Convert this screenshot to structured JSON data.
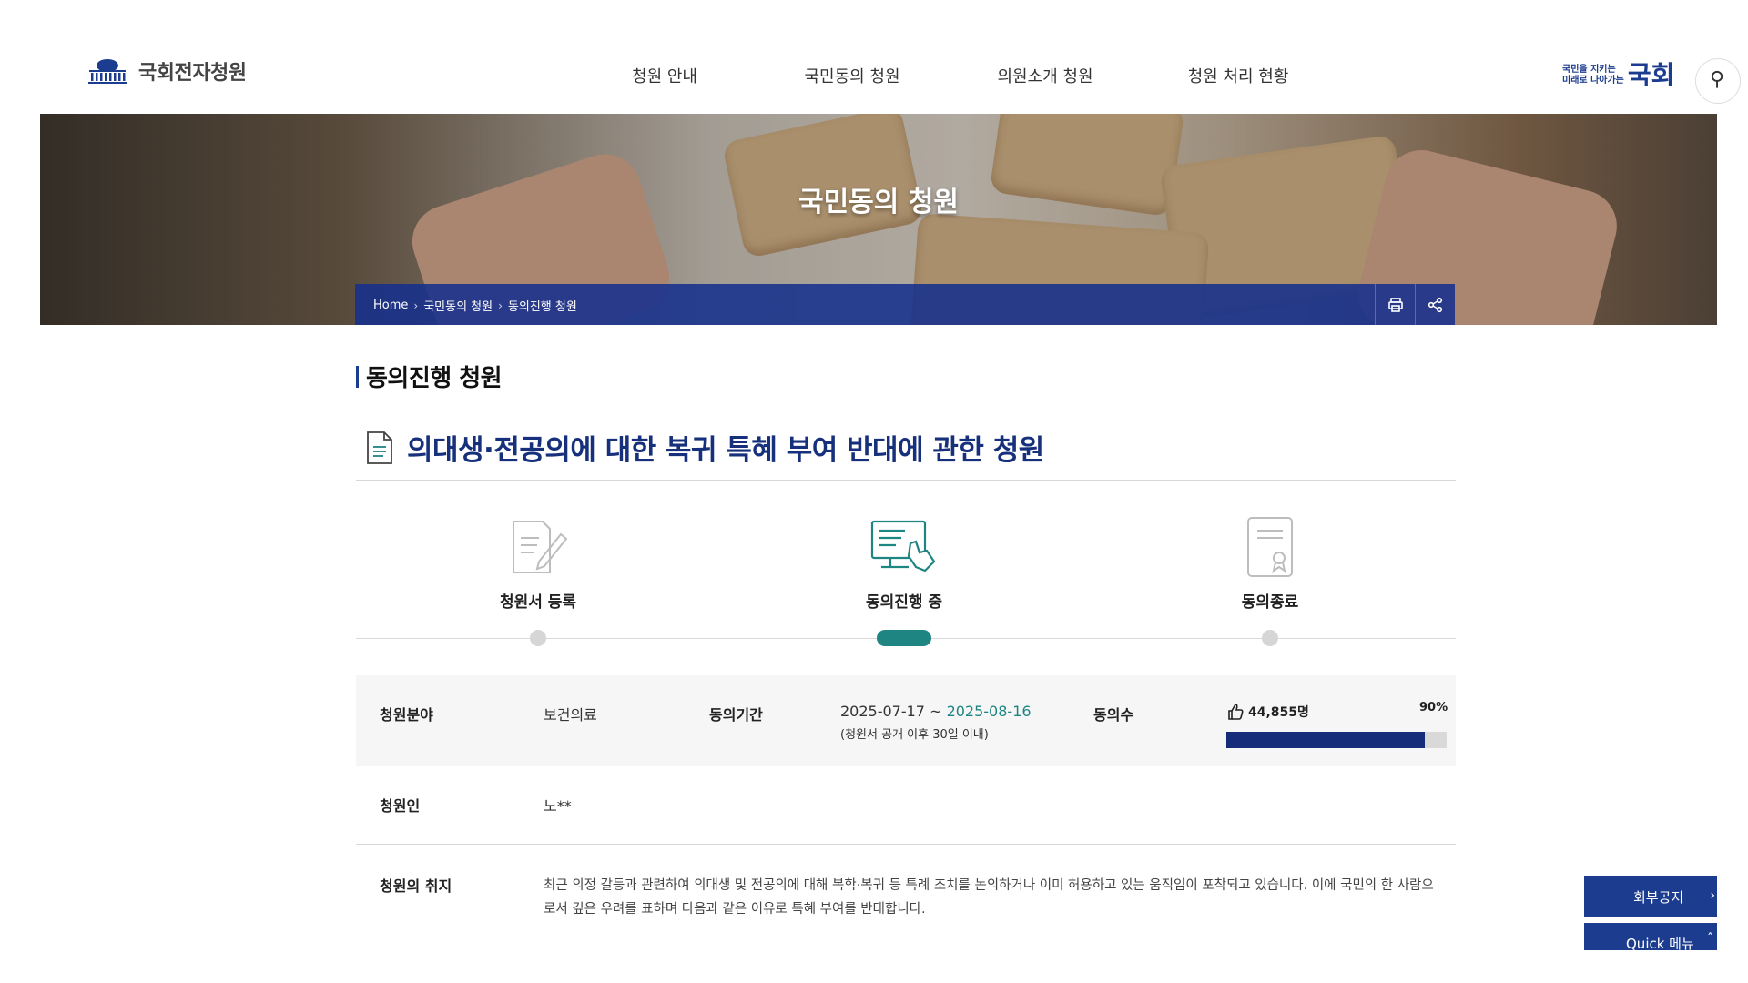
{
  "header": {
    "logo_text": "국회전자청원",
    "nav": [
      "청원 안내",
      "국민동의 청원",
      "의원소개 청원",
      "청원 처리 현황"
    ],
    "brand_line1": "국민을 지키는",
    "brand_line2": "미래로 나아가는",
    "brand_big": "국회"
  },
  "hero": {
    "title": "국민동의 청원",
    "breadcrumb": [
      "Home",
      "국민동의 청원",
      "동의진행 청원"
    ]
  },
  "main": {
    "section_title": "동의진행 청원",
    "petition_title": "의대생·전공의에 대한 복귀 특혜 부여 반대에 관한 청원",
    "steps": [
      {
        "label": "청원서 등록",
        "active": false
      },
      {
        "label": "동의진행 중",
        "active": true
      },
      {
        "label": "동의종료",
        "active": false
      }
    ],
    "info": {
      "field_label": "청원분야",
      "field_value": "보건의료",
      "period_label": "동의기간",
      "period_start": "2025-07-17 ~ ",
      "period_end": "2025-08-16",
      "period_note": "(청원서 공개 이후 30일 이내)",
      "count_label": "동의수",
      "count_value": "44,855명",
      "progress_text": "90%",
      "progress_fraction": 0.9,
      "petitioner_label": "청원인",
      "petitioner_value": "노**",
      "purpose_label": "청원의 취지",
      "purpose_text": "최근 의정 갈등과 관련하여 의대생 및 전공의에 대해 복학·복귀 등 특례 조치를 논의하거나 이미 허용하고 있는 움직임이 포착되고 있습니다. 이에 국민의 한 사람으로서 깊은 우려를 표하며 다음과 같은 이유로 특혜 부여를 반대합니다."
    }
  },
  "floating": {
    "notice": "회부공지",
    "quick": "Quick 메뉴"
  },
  "colors": {
    "navy": "#16307c",
    "teal": "#1f8583",
    "progress": "#142c79"
  }
}
